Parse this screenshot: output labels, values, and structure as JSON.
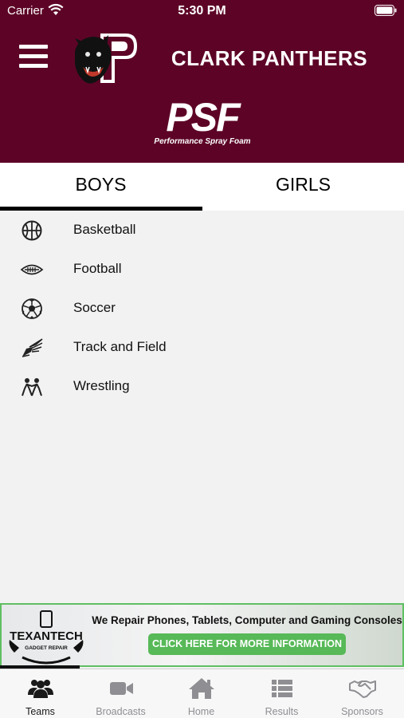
{
  "status_bar": {
    "carrier": "Carrier",
    "time": "5:30 PM"
  },
  "header": {
    "team_name": "CLARK PANTHERS",
    "logo_letter": "P",
    "sponsor_mark": "PSF",
    "sponsor_tagline": "Performance Spray Foam",
    "background_color": "#5d0426"
  },
  "tabs": [
    {
      "label": "BOYS",
      "selected": true
    },
    {
      "label": "GIRLS",
      "selected": false
    }
  ],
  "sports": [
    {
      "label": "Basketball",
      "icon": "basketball-icon"
    },
    {
      "label": "Football",
      "icon": "football-icon"
    },
    {
      "label": "Soccer",
      "icon": "soccer-ball-icon"
    },
    {
      "label": "Track and Field",
      "icon": "winged-shoe-icon"
    },
    {
      "label": "Wrestling",
      "icon": "wrestlers-icon"
    }
  ],
  "ad": {
    "brand_line1": "TEXANTECH",
    "brand_line2": "GADGET REPAIR",
    "headline": "We Repair Phones, Tablets, Computer and Gaming Consoles",
    "cta": "CLICK HERE FOR MORE INFORMATION",
    "accent_color": "#57b957"
  },
  "tab_bar": [
    {
      "label": "Teams",
      "icon": "people-icon",
      "active": true
    },
    {
      "label": "Broadcasts",
      "icon": "video-camera-icon",
      "active": false
    },
    {
      "label": "Home",
      "icon": "home-icon",
      "active": false
    },
    {
      "label": "Results",
      "icon": "list-icon",
      "active": false
    },
    {
      "label": "Sponsors",
      "icon": "handshake-icon",
      "active": false
    }
  ]
}
